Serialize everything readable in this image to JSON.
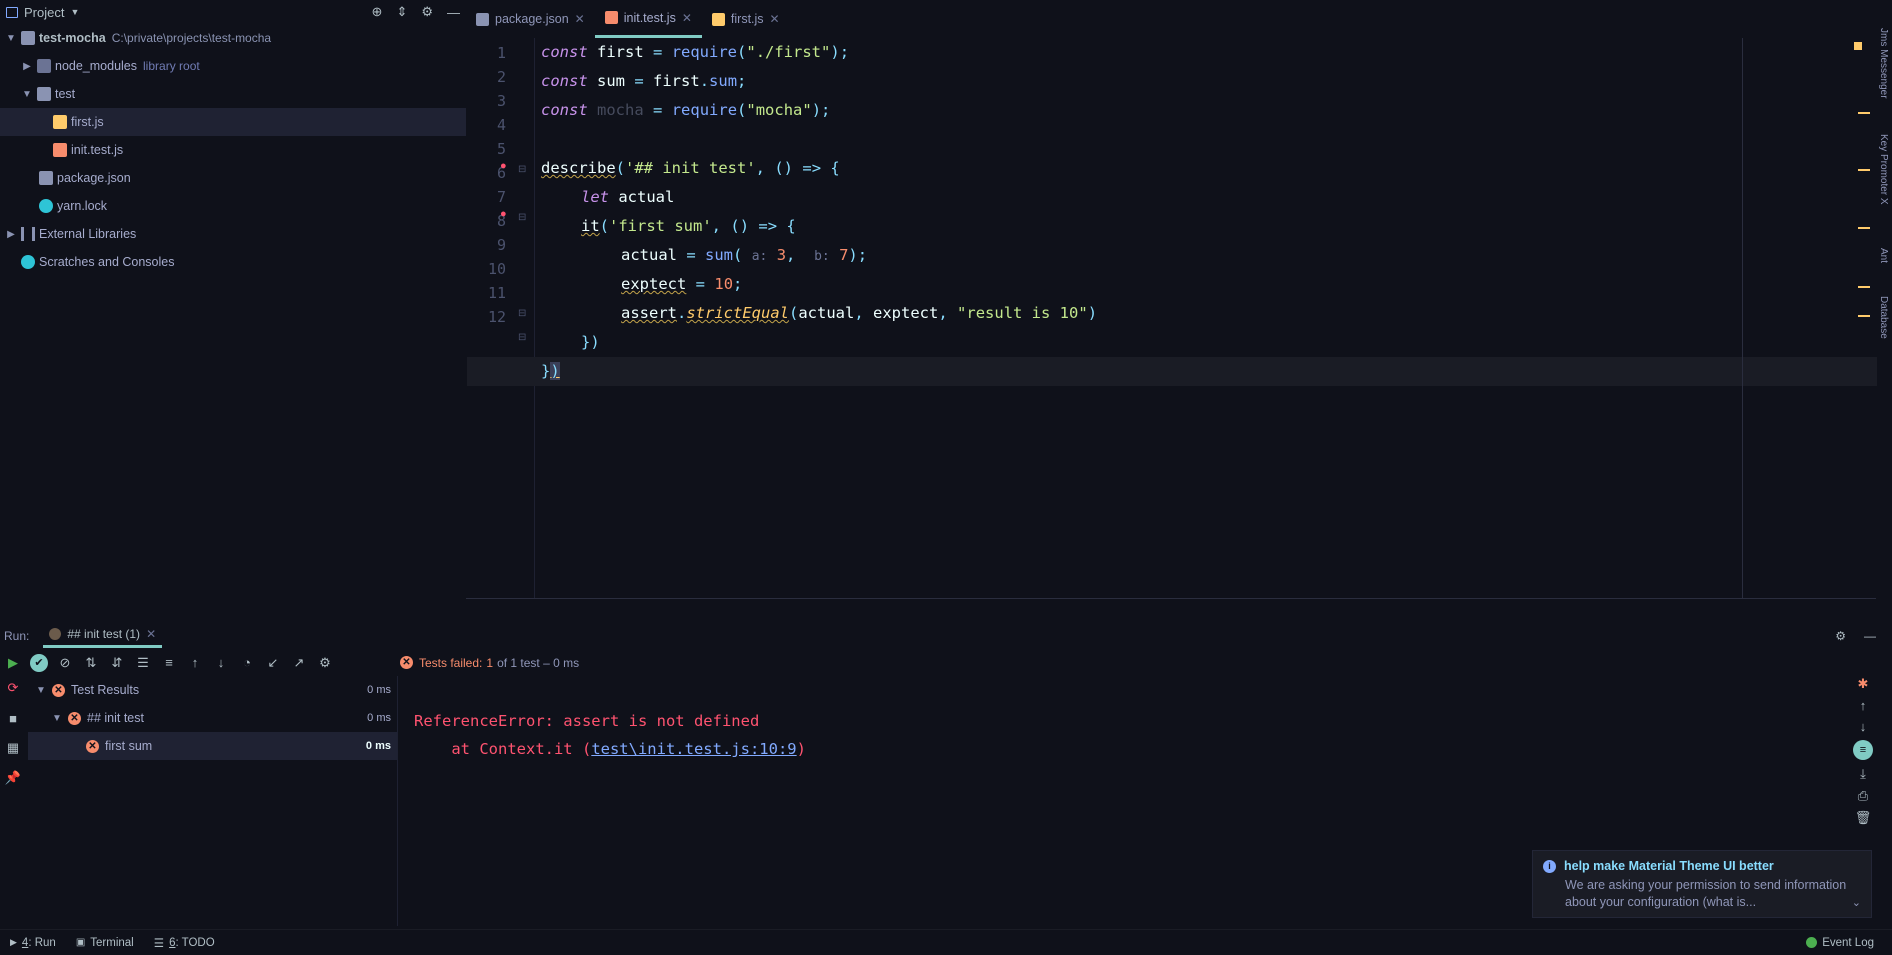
{
  "project_panel": {
    "title": "Project",
    "root": {
      "name": "test-mocha",
      "path": "C:\\private\\projects\\test-mocha"
    },
    "items": [
      {
        "label": "node_modules",
        "hint": "library root"
      },
      {
        "label": "test"
      },
      {
        "label": "first.js"
      },
      {
        "label": "init.test.js"
      },
      {
        "label": "package.json"
      },
      {
        "label": "yarn.lock"
      },
      {
        "label": "External Libraries"
      },
      {
        "label": "Scratches and Consoles"
      }
    ]
  },
  "tabs": [
    {
      "label": "package.json"
    },
    {
      "label": "init.test.js"
    },
    {
      "label": "first.js"
    }
  ],
  "editor": {
    "line_numbers": [
      "1",
      "2",
      "3",
      "4",
      "5",
      "6",
      "7",
      "8",
      "9",
      "10",
      "11",
      "12"
    ]
  },
  "right_bar": {
    "labels": [
      "Jms Messenger",
      "Key Promoter X",
      "Ant",
      "Database"
    ]
  },
  "run": {
    "label": "Run:",
    "tab": "## init test (1)",
    "status_prefix": "Tests failed:",
    "status_count": "1",
    "status_suffix": "of 1 test – 0 ms",
    "results": [
      {
        "label": "Test Results",
        "time": "0 ms"
      },
      {
        "label": "## init test",
        "time": "0 ms"
      },
      {
        "label": "first sum",
        "time": "0 ms"
      }
    ],
    "console": {
      "line1": "ReferenceError: assert is not defined",
      "line2_prefix": "    at Context.it (",
      "line2_link": "test\\init.test.js:10:9",
      "line2_suffix": ")"
    }
  },
  "notification": {
    "title": "help make Material Theme UI better",
    "body": "We are asking your permission to send information about your configuration (what is..."
  },
  "status_bar": {
    "run_num": "4",
    "run": ": Run",
    "terminal": "Terminal",
    "todo_num": "6",
    "todo": ": TODO",
    "event_log": "Event Log"
  },
  "colors": {
    "background": "#0f111a",
    "accent": "#80cbc4",
    "error": "#ff5370"
  }
}
